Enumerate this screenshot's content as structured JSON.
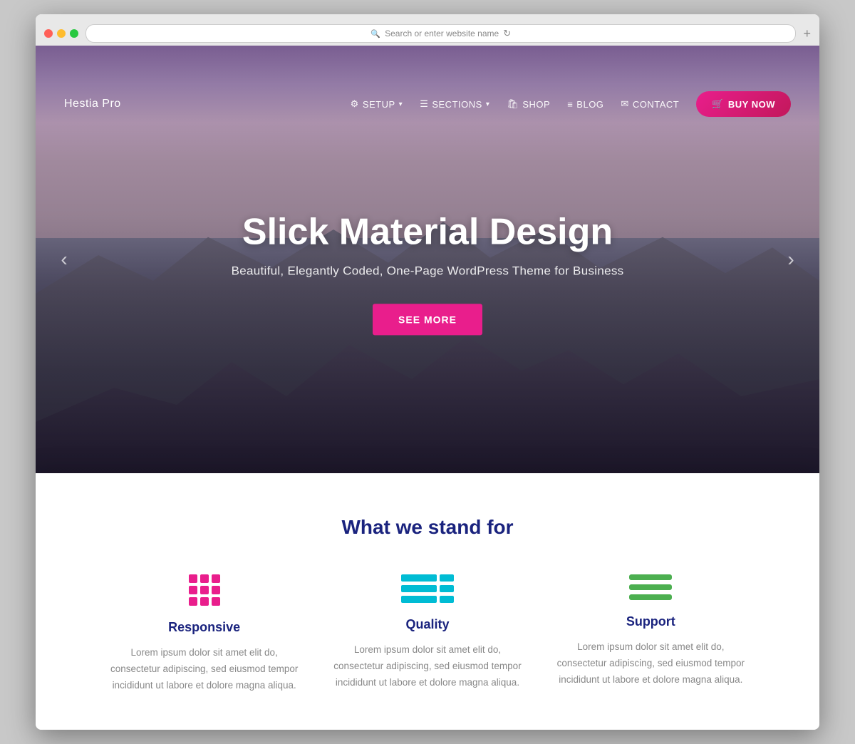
{
  "browser": {
    "search_placeholder": "Search or enter website name"
  },
  "navbar": {
    "brand": "Hestia Pro",
    "links": [
      {
        "id": "setup",
        "label": "SETUP",
        "icon": "⚙",
        "has_dropdown": true
      },
      {
        "id": "sections",
        "label": "SECTIONS",
        "icon": "☰",
        "has_dropdown": true
      },
      {
        "id": "shop",
        "label": "SHOP",
        "icon": "🛍",
        "has_dropdown": false
      },
      {
        "id": "blog",
        "label": "BLOG",
        "icon": "≡",
        "has_dropdown": false
      },
      {
        "id": "contact",
        "label": "CONTACT",
        "icon": "✉",
        "has_dropdown": false
      }
    ],
    "cta_label": "BUY NOW",
    "cta_icon": "🛒"
  },
  "hero": {
    "title": "Slick Material Design",
    "subtitle": "Beautiful, Elegantly Coded, One-Page WordPress Theme for Business",
    "cta_label": "SEE MORE"
  },
  "features": {
    "section_title": "What we stand for",
    "items": [
      {
        "id": "responsive",
        "name": "Responsive",
        "description": "Lorem ipsum dolor sit amet elit do, consectetur adipiscing, sed eiusmod tempor incididunt ut labore et dolore magna aliqua."
      },
      {
        "id": "quality",
        "name": "Quality",
        "description": "Lorem ipsum dolor sit amet elit do, consectetur adipiscing, sed eiusmod tempor incididunt ut labore et dolore magna aliqua."
      },
      {
        "id": "support",
        "name": "Support",
        "description": "Lorem ipsum dolor sit amet elit do, consectetur adipiscing, sed eiusmod tempor incididunt ut labore et dolore magna aliqua."
      }
    ]
  },
  "colors": {
    "pink": "#e91e8c",
    "cyan": "#00bcd4",
    "green": "#4caf50",
    "navy": "#1a237e"
  }
}
